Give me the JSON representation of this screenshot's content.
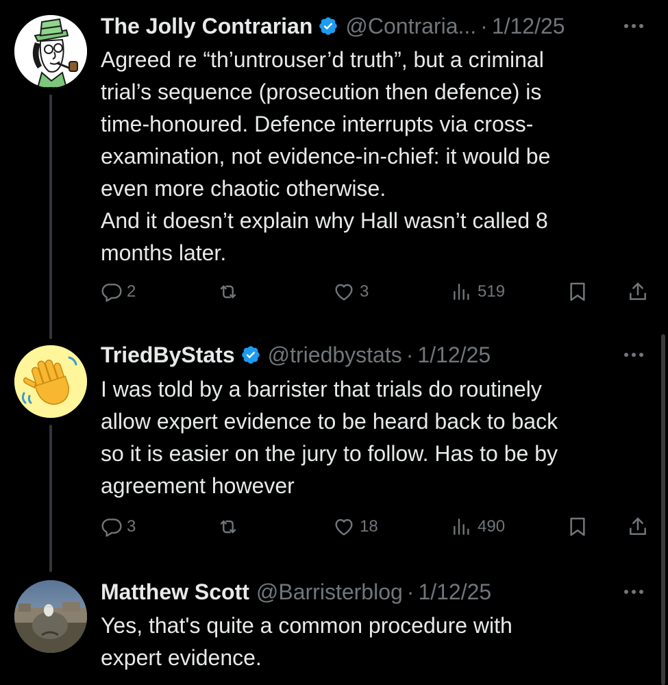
{
  "tweets": [
    {
      "name": "The Jolly Contrarian",
      "verified": true,
      "handle": "@Contraria...",
      "dot": "·",
      "date": "1/12/25",
      "lines": [
        "Agreed re “th’untrouser’d truth”, but a criminal",
        "trial’s sequence (prosecution then defence) is",
        "time-honoured. Defence interrupts via cross-",
        "examination, not evidence-in-chief: it would be",
        "even more chaotic otherwise.",
        "And it doesn’t explain why Hall wasn’t called 8",
        "months later."
      ],
      "replies": "2",
      "reposts": "",
      "likes": "3",
      "views": "519"
    },
    {
      "name": "TriedByStats",
      "verified": true,
      "handle": "@triedbystats",
      "dot": "·",
      "date": "1/12/25",
      "lines": [
        "I was told by a barrister that trials do routinely",
        "allow expert evidence to be heard back to back",
        "so it is easier on the jury to follow. Has to be by",
        "agreement however"
      ],
      "replies": "3",
      "reposts": "",
      "likes": "18",
      "views": "490"
    },
    {
      "name": "Matthew Scott",
      "verified": false,
      "handle": "@Barristerblog",
      "dot": "·",
      "date": "1/12/25",
      "lines": [
        "Yes, that's quite a common procedure with",
        "expert evidence."
      ]
    }
  ],
  "icons": {
    "verified": "verified-badge-icon",
    "more": "more-dots-icon",
    "reply": "reply-icon",
    "repost": "repost-icon",
    "like": "heart-icon",
    "views": "views-chart-icon",
    "bookmark": "bookmark-icon",
    "share": "share-icon"
  },
  "colors": {
    "background": "#000000",
    "text": "#e7e9ea",
    "muted": "#71767b",
    "verified": "#1d9bf0",
    "thread_line": "#333639"
  }
}
